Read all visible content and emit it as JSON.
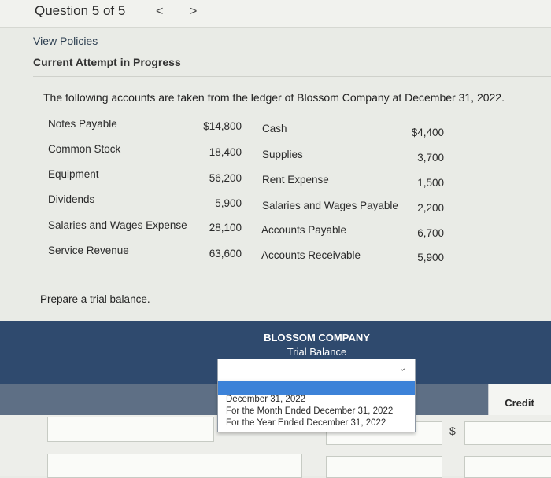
{
  "header": {
    "question_label": "Question 5 of 5"
  },
  "links": {
    "view_policies": "View Policies",
    "attempt_status": "Current Attempt in Progress"
  },
  "problem": {
    "intro": "The following accounts are taken from the ledger of Blossom Company at December 31, 2022.",
    "accounts_left": [
      {
        "name": "Notes Payable",
        "amount": "$14,800"
      },
      {
        "name": "Common Stock",
        "amount": "18,400"
      },
      {
        "name": "Equipment",
        "amount": "56,200"
      },
      {
        "name": "Dividends",
        "amount": "5,900"
      },
      {
        "name": "Salaries and Wages Expense",
        "amount": "28,100"
      },
      {
        "name": "Service Revenue",
        "amount": "63,600"
      }
    ],
    "accounts_right": [
      {
        "name": "Cash",
        "amount": "$4,400"
      },
      {
        "name": "Supplies",
        "amount": "3,700"
      },
      {
        "name": "Rent Expense",
        "amount": "1,500"
      },
      {
        "name": "Salaries and Wages Payable",
        "amount": "2,200"
      },
      {
        "name": "Accounts Payable",
        "amount": "6,700"
      },
      {
        "name": "Accounts Receivable",
        "amount": "5,900"
      }
    ],
    "instruction": "Prepare a trial balance."
  },
  "trial_balance": {
    "company": "BLOSSOM COMPANY",
    "title": "Trial Balance",
    "date_select": {
      "value": "",
      "options": [
        "December 31, 2022",
        "For the Month Ended December 31, 2022",
        "For the Year Ended December 31, 2022"
      ]
    },
    "credit_label": "Credit",
    "currency_symbol": "$"
  },
  "icons": {
    "prev": "chevron-left-icon",
    "next": "chevron-right-icon",
    "select": "chevron-down-icon"
  }
}
